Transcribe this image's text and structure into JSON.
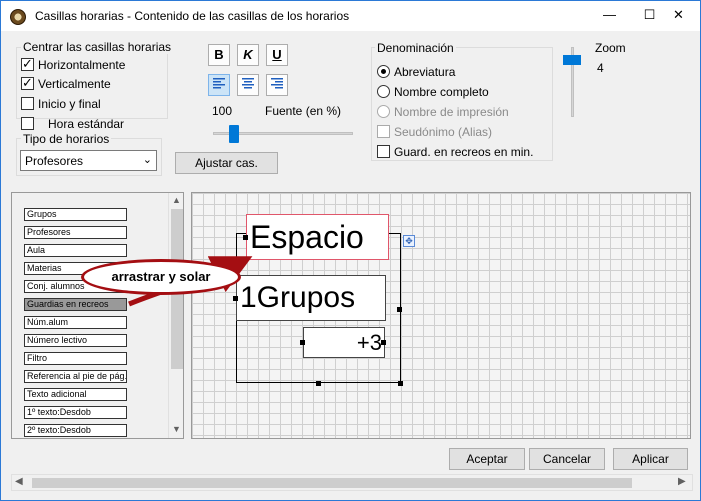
{
  "window": {
    "title": "Casillas horarias - Contenido de las casillas de los horarios",
    "minimize_glyph": "—",
    "maximize_glyph": "☐",
    "close_glyph": "✕"
  },
  "centrar": {
    "label": "Centrar las casillas horarias",
    "horizontal": {
      "label": "Horizontalmente",
      "checked": true
    },
    "vertical": {
      "label": "Verticalmente",
      "checked": true
    },
    "inicio_fin": {
      "label": "Inicio y final",
      "checked": false
    },
    "hora_estandar": {
      "label": "Hora estándar",
      "checked": false
    }
  },
  "tipo_horarios": {
    "label": "Tipo de horarios",
    "selected": "Profesores"
  },
  "format_buttons": {
    "bold": "B",
    "italic": "K",
    "underline": "U"
  },
  "font": {
    "size_value": "100",
    "label": "Fuente (en %)",
    "level_percent": 30
  },
  "ajustar_button": "Ajustar cas.",
  "denominacion": {
    "label": "Denominación",
    "options": [
      {
        "label": "Abreviatura",
        "checked": true,
        "disabled": false
      },
      {
        "label": "Nombre completo",
        "checked": false,
        "disabled": false
      },
      {
        "label": "Nombre de impresión",
        "checked": false,
        "disabled": true
      }
    ],
    "seudonimo": {
      "label": "Seudónimo (Alias)",
      "checked": false,
      "disabled": true
    },
    "guard_recreos": {
      "label": "Guard. en recreos en min.",
      "checked": false,
      "disabled": false
    }
  },
  "zoom": {
    "label": "Zoom",
    "value": "4"
  },
  "list_items": [
    {
      "label": "Grupos",
      "selected": false
    },
    {
      "label": "Profesores",
      "selected": false
    },
    {
      "label": "Aula",
      "selected": false
    },
    {
      "label": "Materias",
      "selected": false
    },
    {
      "label": "Conj. alumnos",
      "selected": false
    },
    {
      "label": "Guardias en recreos",
      "selected": true
    },
    {
      "label": "Núm.alum",
      "selected": false
    },
    {
      "label": "Número lectivo",
      "selected": false
    },
    {
      "label": "Filtro",
      "selected": false
    },
    {
      "label": "Referencia al pie de pág.",
      "selected": false
    },
    {
      "label": "Texto adicional",
      "selected": false
    },
    {
      "label": "1º texto:Desdob",
      "selected": false
    },
    {
      "label": "2º texto:Desdob",
      "selected": false
    }
  ],
  "canvas": {
    "element_espacio": "Espacio",
    "element_grupos": "1Grupos",
    "element_plus": "+3",
    "move_icon": "✥"
  },
  "callout": "arrastrar y solar",
  "buttons": {
    "aceptar": "Aceptar",
    "cancelar": "Cancelar",
    "aplicar": "Aplicar"
  },
  "scroll_glyphs": {
    "up": "▲",
    "down": "▼",
    "left": "◀",
    "right": "▶"
  },
  "colors": {
    "accent": "#0078d7",
    "arrow": "#a40e12",
    "selection_border": "#e0566a"
  }
}
